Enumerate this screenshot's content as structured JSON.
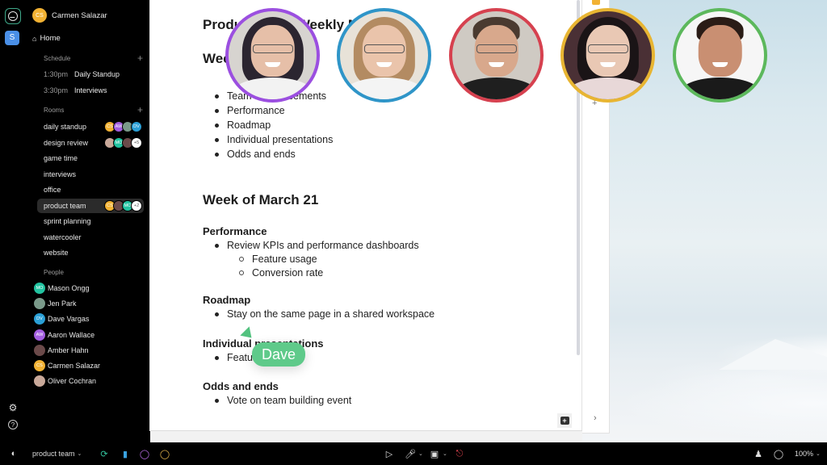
{
  "colors": {
    "accent_green": "#5fca8a",
    "rail_space": "#4a8fe7",
    "sidebar_bg": "#000000",
    "active_room_bg": "#2b2b2b"
  },
  "rail": {
    "logo_icon": "activity-logo-icon",
    "space_label": "S",
    "bottom_icons": [
      "bug-icon",
      "help-icon"
    ]
  },
  "sidebar": {
    "user": {
      "initials": "CS",
      "name": "Carmen Salazar",
      "color": "#f2b233"
    },
    "home_label": "Home",
    "schedule": {
      "label": "Schedule",
      "items": [
        {
          "time": "1:30pm",
          "title": "Daily Standup"
        },
        {
          "time": "3:30pm",
          "title": "Interviews"
        }
      ]
    },
    "rooms": {
      "label": "Rooms",
      "items": [
        {
          "name": "daily standup",
          "avatars": [
            {
              "t": "CS",
              "c": "#f2b233"
            },
            {
              "t": "AW",
              "c": "#a35ee0"
            },
            {
              "t": "",
              "c": "#7a9a8a"
            },
            {
              "t": "DV",
              "c": "#2a9fd6"
            }
          ]
        },
        {
          "name": "design review",
          "avatars": [
            {
              "t": "",
              "c": "#c9a99a"
            },
            {
              "t": "MO",
              "c": "#22c3a0"
            },
            {
              "t": "",
              "c": "#6b4a4a"
            },
            {
              "t": "+5",
              "c": "#ffffff"
            }
          ]
        },
        {
          "name": "game time",
          "avatars": []
        },
        {
          "name": "interviews",
          "avatars": []
        },
        {
          "name": "office",
          "avatars": []
        },
        {
          "name": "product team",
          "active": true,
          "avatars": [
            {
              "t": "CS",
              "c": "#f2b233"
            },
            {
              "t": "",
              "c": "#6b4a4a"
            },
            {
              "t": "MO",
              "c": "#22c3a0"
            },
            {
              "t": "+2",
              "c": "#ffffff"
            }
          ]
        },
        {
          "name": "sprint planning",
          "avatars": []
        },
        {
          "name": "watercooler",
          "avatars": []
        },
        {
          "name": "website",
          "avatars": []
        }
      ]
    },
    "people": {
      "label": "People",
      "items": [
        {
          "name": "Mason Ongg",
          "initials": "MO",
          "color": "#22c3a0"
        },
        {
          "name": "Jen Park",
          "initials": "",
          "color": "#7a9a8a"
        },
        {
          "name": "Dave Vargas",
          "initials": "DV",
          "color": "#2a9fd6"
        },
        {
          "name": "Aaron Wallace",
          "initials": "AW",
          "color": "#a35ee0"
        },
        {
          "name": "Amber Hahn",
          "initials": "",
          "color": "#6b4a4a"
        },
        {
          "name": "Carmen Salazar",
          "initials": "CS",
          "color": "#f2b233"
        },
        {
          "name": "Oliver Cochran",
          "initials": "",
          "color": "#c9a99a"
        }
      ]
    }
  },
  "document": {
    "title": "Product Team Weekly Meetings",
    "section1": {
      "heading": "Week of March 21",
      "bullets": [
        "Team announcements",
        "Performance",
        "Roadmap",
        "Individual presentations",
        "Odds and ends"
      ]
    },
    "section2": {
      "heading": "Week of March 21",
      "groups": [
        {
          "title": "Performance",
          "bullets": [
            {
              "text": "Review KPIs and performance dashboards",
              "sub": [
                "Feature usage",
                "Conversion rate"
              ]
            }
          ]
        },
        {
          "title": "Roadmap",
          "bullets": [
            {
              "text": "Stay on the same page in a shared workspace",
              "sub": []
            }
          ]
        },
        {
          "title": "Individual presentations",
          "bullets": [
            {
              "text": "Features",
              "sub": []
            }
          ]
        },
        {
          "title": "Odds and ends",
          "bullets": [
            {
              "text": "Vote on team building event",
              "sub": []
            }
          ]
        }
      ]
    }
  },
  "cursor": {
    "name": "Dave",
    "color": "#5fca8a"
  },
  "video_participants": [
    {
      "ring": "#9b4fe0",
      "bg": "#d7d4d0",
      "hair": "#2b2530",
      "shirt": "#f2f2f2",
      "skin": "#e6bfa8"
    },
    {
      "ring": "#2f95c8",
      "bg": "#e8e2d8",
      "hair": "#b38b62",
      "shirt": "#f4f4f4",
      "skin": "#eac4ab"
    },
    {
      "ring": "#d6414f",
      "bg": "#cfcac3",
      "hair": "#4a3a30",
      "shirt": "#1f1f1f",
      "skin": "#d8a88c"
    },
    {
      "ring": "#e8b532",
      "bg": "#4a3035",
      "hair": "#1a1416",
      "shirt": "#e8d8d8",
      "skin": "#e9c8b4"
    },
    {
      "ring": "#5cb85c",
      "bg": "#f6f6f6",
      "hair": "#2a1c16",
      "shirt": "#1a1a1a",
      "skin": "#c98f72"
    }
  ],
  "toolbar": {
    "room_name": "product team",
    "left_icons": [
      "sidebar-toggle-icon",
      "refresh-icon",
      "pin-icon",
      "chat-bubble-icon",
      "sticker-icon"
    ],
    "center_icons": [
      "play-icon",
      "microphone-icon",
      "camera-icon",
      "leave-icon"
    ],
    "right_icons": [
      "person-icon",
      "comment-icon"
    ],
    "zoom": "100%"
  }
}
